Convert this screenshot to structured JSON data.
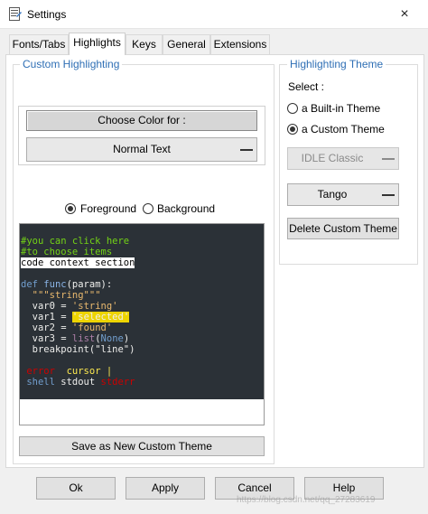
{
  "window": {
    "title": "Settings",
    "close_glyph": "×"
  },
  "tabs": [
    {
      "label": "Fonts/Tabs"
    },
    {
      "label": "Highlights"
    },
    {
      "label": "Keys"
    },
    {
      "label": "General"
    },
    {
      "label": "Extensions"
    }
  ],
  "custom_highlighting": {
    "title": "Custom Highlighting",
    "choose_color_label": "Choose Color for :",
    "element_selector": "Normal Text",
    "foreground_label": "Foreground",
    "background_label": "Background",
    "foreground_selected": true,
    "save_theme_label": "Save as New Custom Theme"
  },
  "code_sample": {
    "line1": "#you can click here",
    "line2": "#to choose items",
    "line3": "code context section",
    "line4_def": "def",
    "line4_func": "func",
    "line4_rest": "(param):",
    "line5": "\"\"\"string\"\"\"",
    "line6_var": "var0 = ",
    "line6_str": "'string'",
    "line7_var": "var1 = ",
    "line7_sel": "'selected'",
    "line8_var": "var2 = ",
    "line8_found": "'found'",
    "line9_var": "var3 = ",
    "line9_builtin": "list",
    "line9_paren": "(",
    "line9_none": "None",
    "line9_close": ")",
    "line10": "breakpoint(\"line\")",
    "line11_error": "error",
    "line11_cursor": "cursor |",
    "line12_shell": "shell",
    "line12_stdout": "stdout",
    "line12_stderr": "stderr"
  },
  "highlighting_theme": {
    "title": "Highlighting Theme",
    "select_label": "Select :",
    "builtin_label": "a Built-in Theme",
    "custom_label": "a Custom Theme",
    "custom_selected": true,
    "builtin_theme": "IDLE Classic",
    "custom_theme": "Tango",
    "delete_label": "Delete Custom Theme"
  },
  "footer": {
    "ok_label": "Ok",
    "apply_label": "Apply",
    "cancel_label": "Cancel",
    "help_label": "Help",
    "watermark": "https://blog.csdn.net/qq_27283619"
  },
  "colors": {
    "comment": "#73d216",
    "keyword": "#729fcf",
    "func": "#8ab3e5",
    "string": "#e9b96e",
    "selected_bg": "#edd400",
    "builtin": "#ad7fa8",
    "error": "#cc0000",
    "cursor": "#fce94f",
    "default_fg": "#eeeeec",
    "group_title": "#2f6fb5"
  }
}
